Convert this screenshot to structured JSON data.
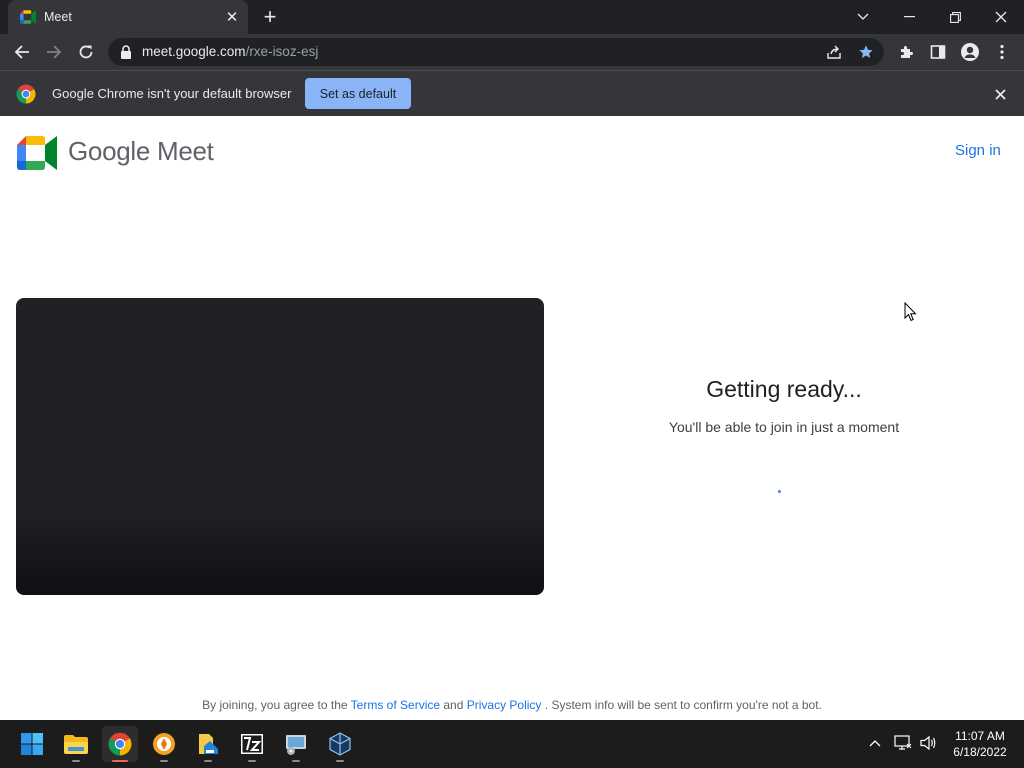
{
  "browser": {
    "tab": {
      "title": "Meet",
      "favicon": "meet-icon"
    },
    "new_tab_label": "+",
    "url_host": "meet.google.com",
    "url_path": "/rxe-isoz-esj"
  },
  "infobar": {
    "message": "Google Chrome isn't your default browser",
    "button_label": "Set as default"
  },
  "page": {
    "brand": "Google Meet",
    "sign_in": "Sign in",
    "ready_title": "Getting ready...",
    "ready_subtitle": "You'll be able to join in just a moment",
    "terms": {
      "prefix": "By joining, you agree to the",
      "tos": "Terms of Service",
      "and": "and",
      "privacy": "Privacy Policy",
      "suffix": ". System info will be sent to confirm you're not a bot."
    }
  },
  "taskbar": {
    "time": "11:07 AM",
    "date": "6/18/2022",
    "apps": [
      "start",
      "file-explorer",
      "chrome",
      "privacy-browser",
      "file-manager",
      "7zip",
      "network-app",
      "virtualbox"
    ]
  },
  "colors": {
    "accent": "#1a73e8",
    "chrome_dark": "#35363a",
    "infobar_button": "#8ab4f8"
  }
}
